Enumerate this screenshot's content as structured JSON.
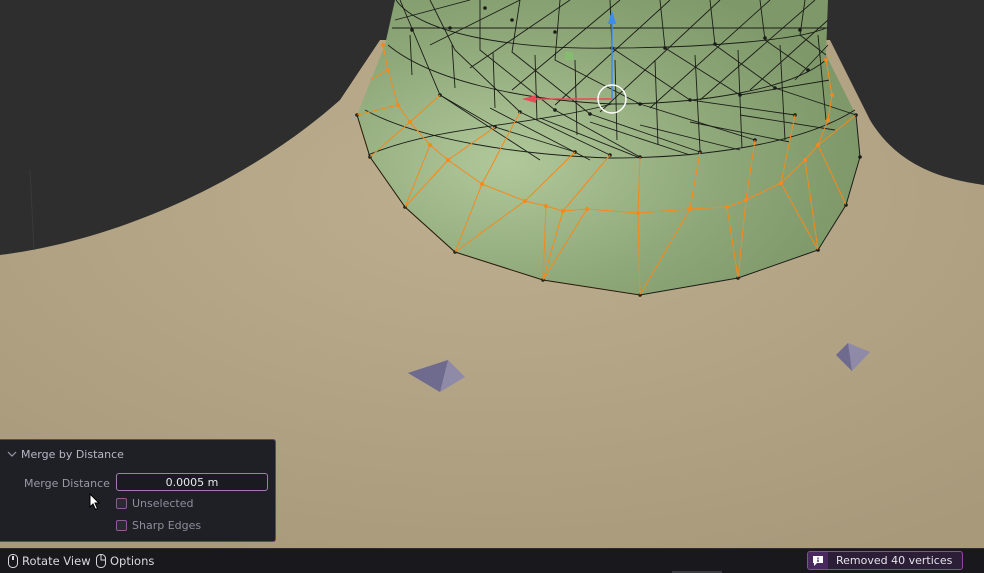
{
  "operator_panel": {
    "title": "Merge by Distance",
    "merge_distance": {
      "label": "Merge Distance",
      "value": "0.0005 m"
    },
    "unselected": {
      "label": "Unselected",
      "checked": false
    },
    "sharp_edges": {
      "label": "Sharp Edges",
      "checked": false
    }
  },
  "statusbar": {
    "rotate_view": "Rotate View",
    "options": "Options",
    "report": "Removed 40 vertices"
  },
  "colors": {
    "background": "#2e2e2e",
    "body_surface": "#b0a283",
    "mesh_green": "#8fa87a",
    "selected_edge": "#f5891c",
    "panel_bg": "#1f1f26",
    "panel_accent": "#8c4aa0"
  }
}
